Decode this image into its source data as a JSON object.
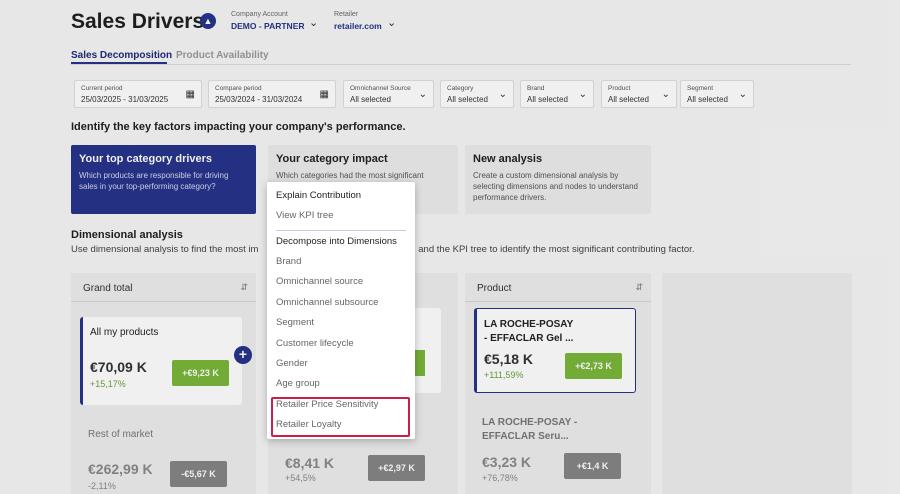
{
  "header": {
    "title": "Sales Drivers",
    "company_label": "Company Account",
    "company_value": "DEMO - PARTNER",
    "retailer_label": "Retailer",
    "retailer_value": "retailer.com"
  },
  "tabs": [
    {
      "label": "Sales Decomposition",
      "active": true
    },
    {
      "label": "Product Availability",
      "active": false
    }
  ],
  "filters": [
    {
      "label": "Current period",
      "value": "25/03/2025 - 31/03/2025",
      "icon": "calendar-icon"
    },
    {
      "label": "Compare period",
      "value": "25/03/2024 - 31/03/2024",
      "icon": "calendar-icon"
    },
    {
      "label": "Omnichannel Source",
      "value": "All selected",
      "icon": "chevron-down-icon"
    },
    {
      "label": "Category",
      "value": "All selected",
      "icon": "chevron-down-icon"
    },
    {
      "label": "Brand",
      "value": "All selected",
      "icon": "chevron-down-icon"
    },
    {
      "label": "Product",
      "value": "All selected",
      "icon": "chevron-down-icon"
    },
    {
      "label": "Segment",
      "value": "All selected",
      "icon": "chevron-down-icon"
    }
  ],
  "intro": {
    "heading": "Identify the key factors impacting your company's performance."
  },
  "cards": [
    {
      "title": "Your top category drivers",
      "text": "Which products are responsible for driving sales in your top-performing category?"
    },
    {
      "title": "Your category impact",
      "text": "Which categories had the most significant"
    },
    {
      "title": "New analysis",
      "text": "Create a custom dimensional analysis by selecting dimensions and nodes to understand performance drivers."
    }
  ],
  "dimensional": {
    "heading": "Dimensional analysis",
    "text_left": "Use dimensional analysis to find the most im",
    "text_right": ", and the KPI tree to identify the most significant contributing factor."
  },
  "columns": {
    "grand_total": {
      "header": "Grand total",
      "node": {
        "title": "All my products",
        "value": "€70,09 K",
        "pct": "+15,17%",
        "badge": "+€9,23 K"
      },
      "ghost": {
        "title": "Rest of market",
        "value": "€262,99 K",
        "pct": "-2,11%",
        "badge": "-€5,67 K"
      }
    },
    "middle": {
      "ghost": {
        "value": "€8,41 K",
        "pct": "+54,5%",
        "badge": "+€2,97 K"
      }
    },
    "product": {
      "header": "Product",
      "node": {
        "title": "LA ROCHE-POSAY - EFFACLAR Gel ...",
        "value": "€5,18 K",
        "pct": "+111,59%",
        "badge": "+€2,73 K"
      },
      "ghost": {
        "title": "LA ROCHE-POSAY - EFFACLAR Seru...",
        "value": "€3,23 K",
        "pct": "+76,78%",
        "badge": "+€1,4 K"
      }
    }
  },
  "menu": {
    "items": [
      "Explain Contribution",
      "View KPI tree",
      "Decompose into Dimensions",
      "Brand",
      "Omnichannel source",
      "Omnichannel subsource",
      "Segment",
      "Customer lifecycle",
      "Gender",
      "Age group",
      "Retailer Price Sensitivity",
      "Retailer Loyalty"
    ]
  },
  "colors": {
    "brand": "#27348b",
    "positive": "#7ab63a",
    "highlight": "#c8204a"
  }
}
